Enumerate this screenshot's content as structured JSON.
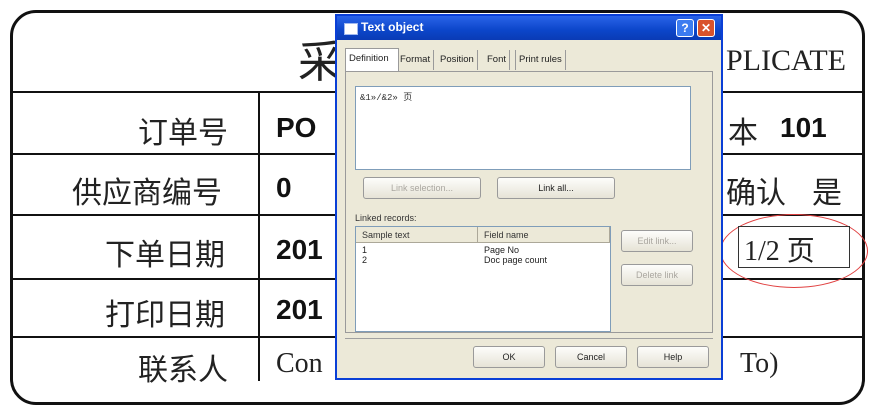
{
  "document": {
    "title_glyph": "采",
    "duplicate_text": "PLICATE",
    "rows": [
      {
        "label": "订单号",
        "value": "PO"
      },
      {
        "label": "供应商编号",
        "value": "0"
      },
      {
        "label": "下单日期",
        "value": "201"
      },
      {
        "label": "打印日期",
        "value": "201"
      },
      {
        "label": "联系人",
        "value": "Con"
      }
    ],
    "right_col": {
      "version_label": "本",
      "version_value": "101",
      "confirm_label": "确认",
      "confirm_value": "是",
      "page_indicator": "1/2 页",
      "contact_suffix": "To)"
    }
  },
  "dialog": {
    "title": "Text object",
    "help_glyph": "?",
    "close_glyph": "✕",
    "tabs": [
      "Definition",
      "Format",
      "Position",
      "Font",
      "Print rules"
    ],
    "text_content": "&1»/&2» 页",
    "link_selection_button": "Link selection...",
    "link_all_button": "Link all...",
    "linked_records_label": "Linked records:",
    "list_headers": [
      "Sample text",
      "Field name"
    ],
    "list_rows": [
      {
        "sample": "1",
        "field": "Page No"
      },
      {
        "sample": "2",
        "field": "Doc page count"
      }
    ],
    "edit_link_button": "Edit link...",
    "delete_link_button": "Delete link",
    "ok_button": "OK",
    "cancel_button": "Cancel",
    "help_button": "Help"
  },
  "colors": {
    "dialog_title_bar": "#0b45c9",
    "close_button": "#d9532c",
    "annotation_circle": "#e04040"
  }
}
